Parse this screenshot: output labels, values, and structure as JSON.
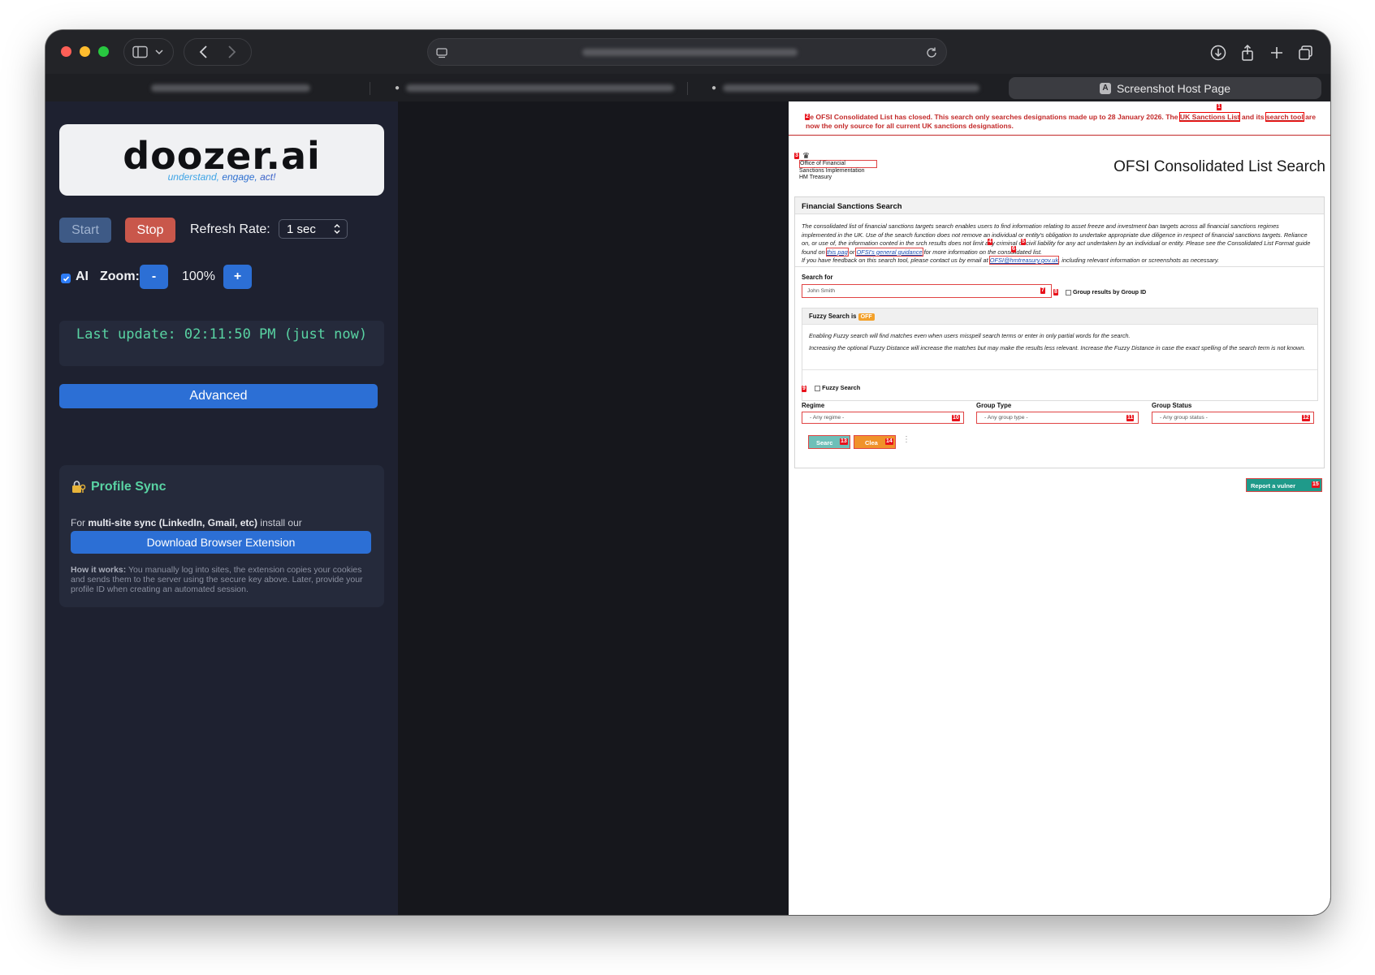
{
  "browser": {
    "active_tab_label": "Screenshot Host Page",
    "active_tab_favicon": "A"
  },
  "panel": {
    "logo": "doozer.ai",
    "tagline_parts": [
      "understand,",
      "engage,",
      "act!"
    ],
    "start_label": "Start",
    "stop_label": "Stop",
    "refresh_label": "Refresh Rate:",
    "refresh_value": "1 sec",
    "ai_label": "AI",
    "zoom_label": "Zoom:",
    "zoom_minus": "-",
    "zoom_plus": "+",
    "zoom_value": "100%",
    "last_update": "Last update: 02:11:50 PM (just now)",
    "advanced_label": "Advanced",
    "sync": {
      "title": "Profile Sync",
      "desc_prefix": "For",
      "desc_bold": "multi-site sync (LinkedIn, Gmail, etc)",
      "desc_suffix": "install our",
      "download_label": "Download Browser Extension",
      "how_bold": "How it works:",
      "how_text": "You manually log into sites, the extension copies your cookies and sends them to the server using the secure key above. Later, provide your profile ID when creating an automated session."
    }
  },
  "page": {
    "banner": {
      "text_1": "he OFSI Consolidated List has closed. This search only searches designations made up to 28 January 2026. The",
      "link_1": "UK Sanctions List",
      "text_2": "and its",
      "link_2": "search tool",
      "text_3": "are now the only source for all current UK sanctions designations."
    },
    "crest_lines": [
      "Office of Financial",
      "Sanctions Implementation",
      "HM Treasury"
    ],
    "title": "OFSI Consolidated List Search",
    "fs_heading": "Financial Sanctions Search",
    "fs_para_1a": "The consolidated list of financial sanctions targets search enables users to find information relating to asset freeze and investment ban targets across all financial sanctions regimes implemented in the UK. Use of the search function does not remove an individual or entity's obligation to undertake appropriate due diligence in respect of financial sanctions targets. Reliance on, or use of, the information cont",
    "fs_para_1b": "ed in the s",
    "fs_para_1c": "rch results does not limit any criminal or civil liability for any act undertaken by an individual or entity. Please see the Consolidated List Format guide found on",
    "fs_link_1": "this pag",
    "fs_para_1d": "or",
    "fs_link_2": "OFSI's general guidance",
    "fs_para_1e": "for more information on the consolidated list.",
    "fs_para_2a": "If you have feedback on this search tool, please contact us by email at",
    "fs_link_3": "OFSI@hmtreasury.gov.uk",
    "fs_para_2b": ", including relevant information or screenshots as necessary.",
    "search_for_label": "Search for",
    "search_placeholder": "John Smith",
    "group_by_label": "Group results by Group ID",
    "fuzzy_heading": "Fuzzy Search is",
    "fuzzy_state": "OFF",
    "fuzzy_text_1": "Enabling Fuzzy search will find matches even when users misspell search terms or enter in only partial words for the search.",
    "fuzzy_text_2": "Increasing the optional Fuzzy Distance will increase the matches but may make the results less relevant. Increase the Fuzzy Distance in case the exact spelling of the search term is not known.",
    "fuzzy_check_label": "Fuzzy Search",
    "regime_label": "Regime",
    "regime_value": "- Any regime -",
    "group_type_label": "Group Type",
    "group_type_value": "- Any group type -",
    "group_status_label": "Group Status",
    "group_status_value": "- Any group status -",
    "search_btn": "Searc",
    "clear_btn": "Clea",
    "report_btn": "Report a vulner",
    "tags": [
      "1",
      "2",
      "3",
      "4",
      "5",
      "6",
      "7",
      "8",
      "9",
      "10",
      "11",
      "12",
      "13",
      "14",
      "15"
    ]
  },
  "colors": {
    "panel_bg": "#1e2130",
    "accent_blue": "#2c6fd5",
    "stop_red": "#c9574b",
    "mint": "#59d3a3",
    "tag_red": "#e8121b"
  }
}
